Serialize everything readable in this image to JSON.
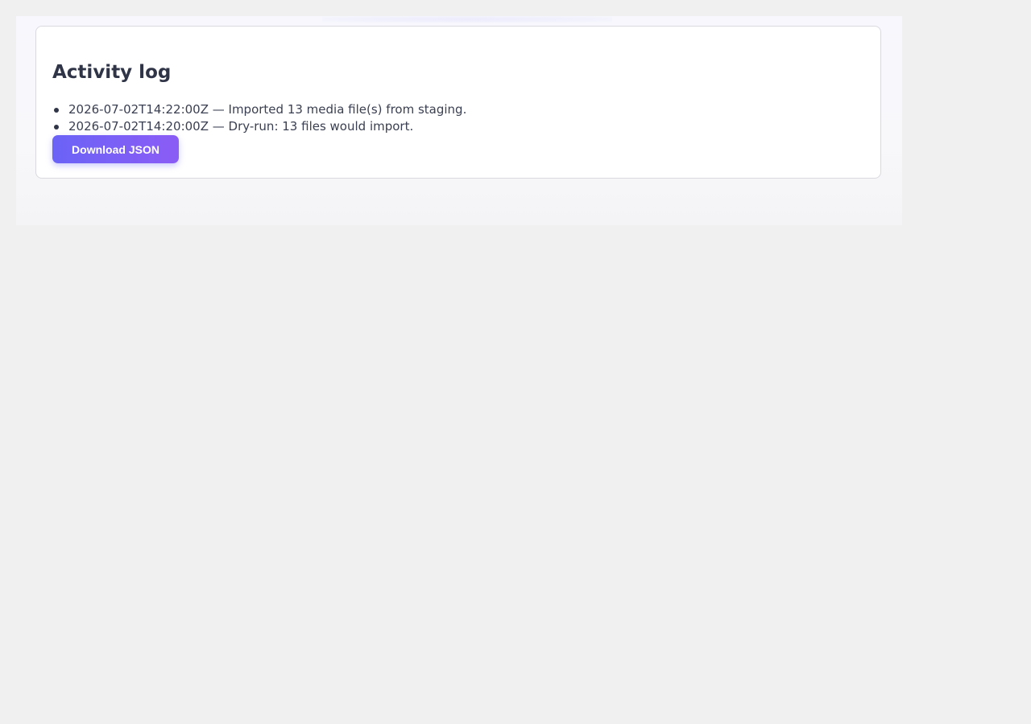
{
  "activity": {
    "title": "Activity log",
    "entries": [
      "2026-07-02T14:22:00Z — Imported 13 media file(s) from staging.",
      "2026-07-02T14:20:00Z — Dry-run: 13 files would import."
    ],
    "download_label": "Download JSON"
  },
  "colors": {
    "accent_start": "#6b63f6",
    "accent_end": "#8b5cf6",
    "page_background": "#f0f0f0",
    "card_background": "#ffffff"
  }
}
